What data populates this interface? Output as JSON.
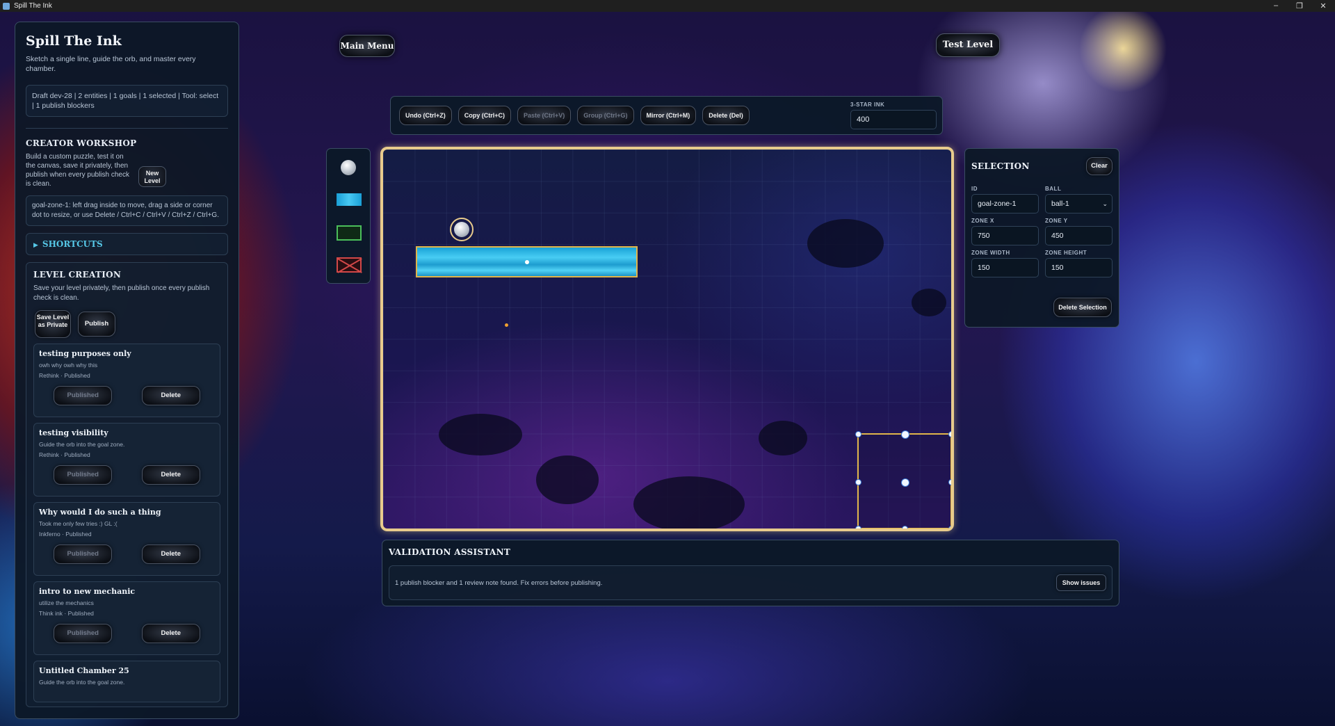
{
  "window": {
    "title": "Spill The Ink",
    "controls": [
      "–",
      "❐",
      "✕"
    ]
  },
  "sidebar": {
    "app_title": "Spill The Ink",
    "tagline": "Sketch a single line, guide the orb, and master every chamber.",
    "status": "Draft dev-28 | 2 entities | 1 goals | 1 selected | Tool: select | 1 publish blockers",
    "workshop": {
      "heading": "CREATOR WORKSHOP",
      "text": "Build a custom puzzle, test it on the canvas, save it privately, then publish when every publish check is clean.",
      "new_level_label": "New Level"
    },
    "selection_info": "goal-zone-1: left drag inside to move, drag a side or corner dot to resize, or use Delete / Ctrl+C / Ctrl+V / Ctrl+Z / Ctrl+G.",
    "shortcuts_label": "SHORTCUTS",
    "level_creation": {
      "heading": "LEVEL CREATION",
      "text": "Save your level privately, then publish once every publish check is clean.",
      "save_label": "Save Level as Private",
      "publish_label": "Publish"
    },
    "levels": [
      {
        "title": "testing purposes only",
        "desc": "owh why owh why this",
        "meta": "Rethink · Published",
        "published_label": "Published",
        "delete_label": "Delete"
      },
      {
        "title": "testing visibility",
        "desc": "Guide the orb into the goal zone.",
        "meta": "Rethink · Published",
        "published_label": "Published",
        "delete_label": "Delete"
      },
      {
        "title": "Why would I do such a thing",
        "desc": "Took me only few tries :) GL :(",
        "meta": "Inkferno · Published",
        "published_label": "Published",
        "delete_label": "Delete"
      },
      {
        "title": "intro to new mechanic",
        "desc": "utilize the mechanics",
        "meta": "Think ink · Published",
        "published_label": "Published",
        "delete_label": "Delete"
      },
      {
        "title": "Untitled Chamber 25",
        "desc": "Guide the orb into the goal zone."
      }
    ]
  },
  "top_buttons": {
    "main_menu": "Main Menu",
    "test_level": "Test Level"
  },
  "toolbar": {
    "buttons": [
      {
        "label": "Undo (Ctrl+Z)",
        "enabled": true
      },
      {
        "label": "Copy (Ctrl+C)",
        "enabled": true
      },
      {
        "label": "Paste (Ctrl+V)",
        "enabled": false
      },
      {
        "label": "Group (Ctrl+G)",
        "enabled": false
      },
      {
        "label": "Mirror (Ctrl+M)",
        "enabled": true
      },
      {
        "label": "Delete (Del)",
        "enabled": true
      }
    ],
    "ink_label": "3-STAR INK",
    "ink_value": "400"
  },
  "palette": {
    "tools": [
      "ball-tool",
      "water-tool",
      "goal-zone-tool",
      "hazard-tool"
    ]
  },
  "selection_panel": {
    "title": "SELECTION",
    "clear_label": "Clear",
    "id_label": "ID",
    "id_value": "goal-zone-1",
    "ball_label": "BALL",
    "ball_value": "ball-1",
    "zone_x_label": "ZONE X",
    "zone_x_value": "750",
    "zone_y_label": "ZONE Y",
    "zone_y_value": "450",
    "zone_width_label": "ZONE WIDTH",
    "zone_width_value": "150",
    "zone_height_label": "ZONE HEIGHT",
    "zone_height_value": "150",
    "delete_label": "Delete Selection"
  },
  "validation": {
    "title": "VALIDATION ASSISTANT",
    "message": "1 publish blocker and 1 review note found. Fix errors before publishing.",
    "show_label": "Show issues"
  },
  "colors": {
    "panel_bg": "#0c1828",
    "canvas_border": "#e8cb8c",
    "water": "#48cdf3",
    "goal_zone_border": "#e0b54a",
    "accent_cyan": "#56c7e6"
  }
}
